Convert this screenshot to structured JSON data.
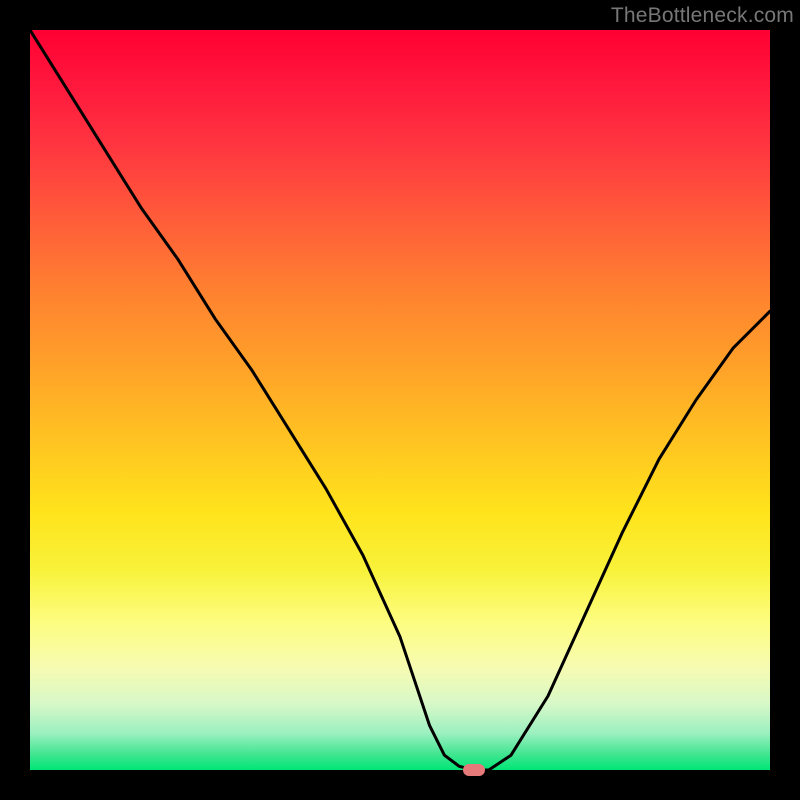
{
  "watermark": "TheBottleneck.com",
  "chart_data": {
    "type": "line",
    "title": "",
    "xlabel": "",
    "ylabel": "",
    "xlim": [
      0,
      100
    ],
    "ylim": [
      0,
      100
    ],
    "x": [
      0,
      5,
      10,
      15,
      20,
      25,
      30,
      35,
      40,
      45,
      50,
      52,
      54,
      56,
      58,
      60,
      62,
      65,
      70,
      75,
      80,
      85,
      90,
      95,
      100
    ],
    "y": [
      100,
      92,
      84,
      76,
      69,
      61,
      54,
      46,
      38,
      29,
      18,
      12,
      6,
      2,
      0.5,
      0,
      0,
      2,
      10,
      21,
      32,
      42,
      50,
      57,
      62
    ],
    "marker": {
      "x": 60,
      "y": 0
    },
    "gradient_stops": [
      {
        "pos": 0,
        "color": "#ff0033"
      },
      {
        "pos": 25,
        "color": "#ff5a3a"
      },
      {
        "pos": 55,
        "color": "#ffc222"
      },
      {
        "pos": 80,
        "color": "#fdfd80"
      },
      {
        "pos": 95,
        "color": "#9cf0c0"
      },
      {
        "pos": 100,
        "color": "#00e676"
      }
    ]
  }
}
